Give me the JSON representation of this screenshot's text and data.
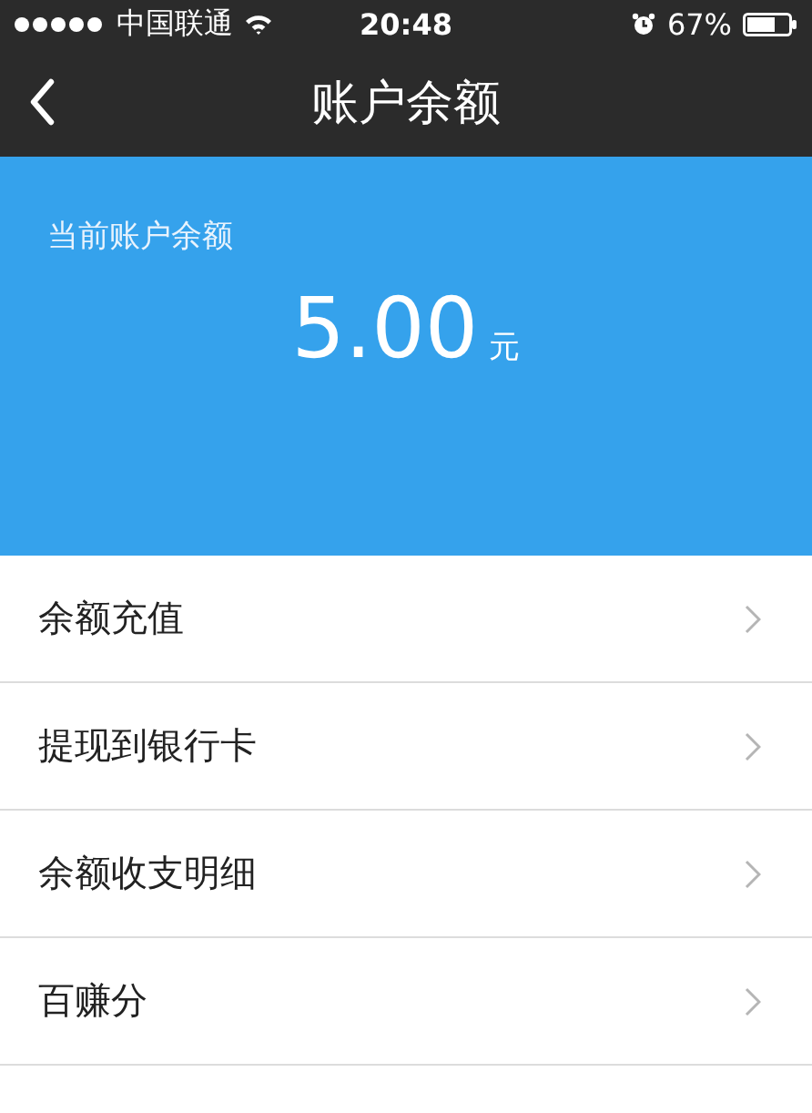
{
  "status_bar": {
    "carrier": "中国联通",
    "time": "20:48",
    "battery": "67%"
  },
  "nav_bar": {
    "title": "账户余额"
  },
  "balance_panel": {
    "label": "当前账户余额",
    "amount": "5.00",
    "unit": "元"
  },
  "menu_items": [
    {
      "label": "余额充值"
    },
    {
      "label": "提现到银行卡"
    },
    {
      "label": "余额收支明细"
    },
    {
      "label": "百赚分"
    }
  ]
}
